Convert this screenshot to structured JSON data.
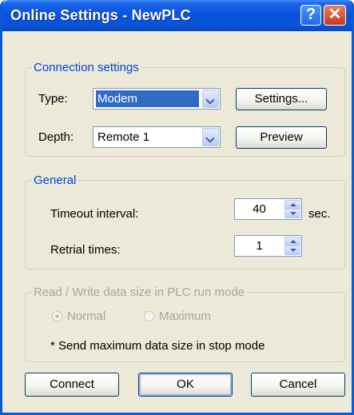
{
  "window": {
    "title": "Online Settings - NewPLC"
  },
  "titlebar": {
    "help_glyph": "?",
    "close_glyph": "✕"
  },
  "connection": {
    "group_label": "Connection settings",
    "type_label": "Type:",
    "type_value": "Modem",
    "depth_label": "Depth:",
    "depth_value": "Remote 1",
    "settings_button": "Settings...",
    "preview_button": "Preview"
  },
  "general": {
    "group_label": "General",
    "timeout_label": "Timeout interval:",
    "timeout_value": "40",
    "timeout_unit": "sec.",
    "retrial_label": "Retrial times:",
    "retrial_value": "1"
  },
  "rw": {
    "group_label": "Read / Write data size in PLC run mode",
    "normal_label": "Normal",
    "maximum_label": "Maximum",
    "selected": "Normal",
    "note": "* Send maximum data size in stop mode"
  },
  "buttons": {
    "connect": "Connect",
    "ok": "OK",
    "cancel": "Cancel"
  },
  "colors": {
    "title_bar": "#0a54dc",
    "dialog_bg": "#ece9d8",
    "group_label": "#0046d5",
    "selection": "#316ac5",
    "close_button": "#c6391b"
  },
  "icons": {
    "help": "help-icon",
    "close": "close-icon",
    "dropdown": "chevron-down-icon",
    "spin_up": "spin-up-icon",
    "spin_down": "spin-down-icon"
  }
}
